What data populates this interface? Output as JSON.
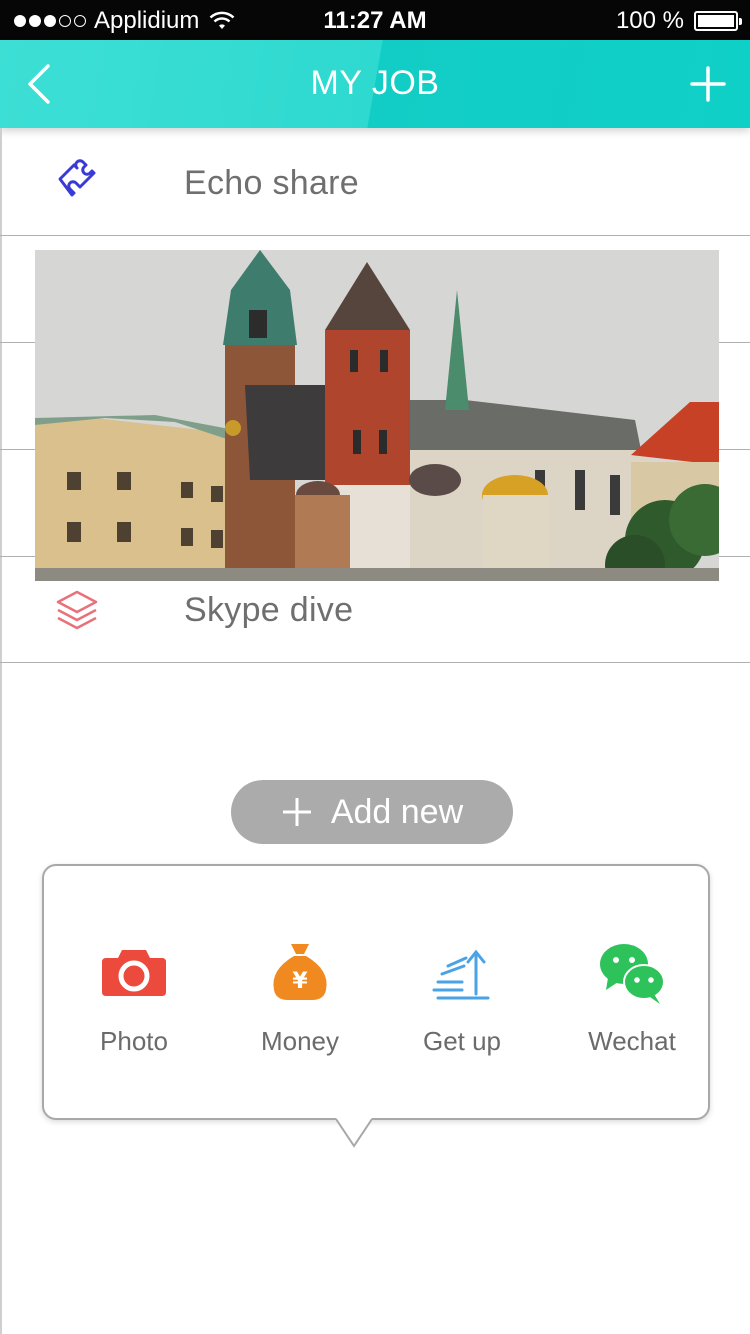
{
  "status_bar": {
    "carrier": "Applidium",
    "time": "11:27 AM",
    "battery": "100 %",
    "signal_full": 3,
    "signal_empty": 2
  },
  "nav": {
    "title": "MY JOB",
    "back_icon": "chevron-left-icon",
    "add_icon": "plus-icon"
  },
  "jobs": [
    {
      "label": "Echo share",
      "icon": "puzzle-icon",
      "color": "#3a3ad6"
    },
    {
      "label": "Skype  dive",
      "icon": "layers-icon",
      "color": "#e8717a"
    }
  ],
  "photo": {
    "subject": "castle-photo"
  },
  "add_new": {
    "label": "Add new",
    "icon": "plus-icon"
  },
  "share_menu": {
    "items": [
      {
        "label": "Photo",
        "icon": "camera-icon",
        "color": "#ec4a3c"
      },
      {
        "label": "Money",
        "icon": "money-bag-icon",
        "color": "#f08a20"
      },
      {
        "label": "Get up",
        "icon": "upload-icon",
        "color": "#4aa3e6"
      },
      {
        "label": "Wechat",
        "icon": "wechat-icon",
        "color": "#2dc25a"
      }
    ]
  },
  "colors": {
    "nav": "#1fd3ca",
    "button": "#ababab"
  }
}
